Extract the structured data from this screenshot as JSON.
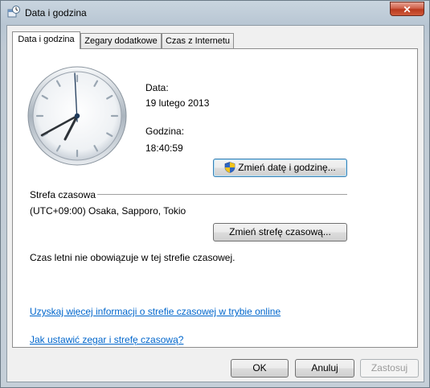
{
  "window": {
    "title": "Data i godzina",
    "close_label": "✕"
  },
  "tabs": [
    {
      "label": "Data i godzina"
    },
    {
      "label": "Zegary dodatkowe"
    },
    {
      "label": "Czas z Internetu"
    }
  ],
  "datetime": {
    "date_label": "Data:",
    "date_value": "19 lutego 2013",
    "time_label": "Godzina:",
    "time_value": "18:40:59",
    "change_button": "Zmień datę i godzinę..."
  },
  "timezone": {
    "section_label": "Strefa czasowa",
    "value": "(UTC+09:00) Osaka, Sapporo, Tokio",
    "change_button": "Zmień strefę czasową...",
    "dst_note": "Czas letni nie obowiązuje w tej strefie czasowej."
  },
  "links": {
    "more_info": "Uzyskaj więcej informacji o strefie czasowej w trybie online",
    "how_to": "Jak ustawić zegar i strefę czasową?"
  },
  "footer": {
    "ok": "OK",
    "cancel": "Anuluj",
    "apply": "Zastosuj"
  },
  "icons": {
    "clock": "analog-clock",
    "shield": "uac-shield-icon",
    "window": "datetime-app-icon"
  }
}
